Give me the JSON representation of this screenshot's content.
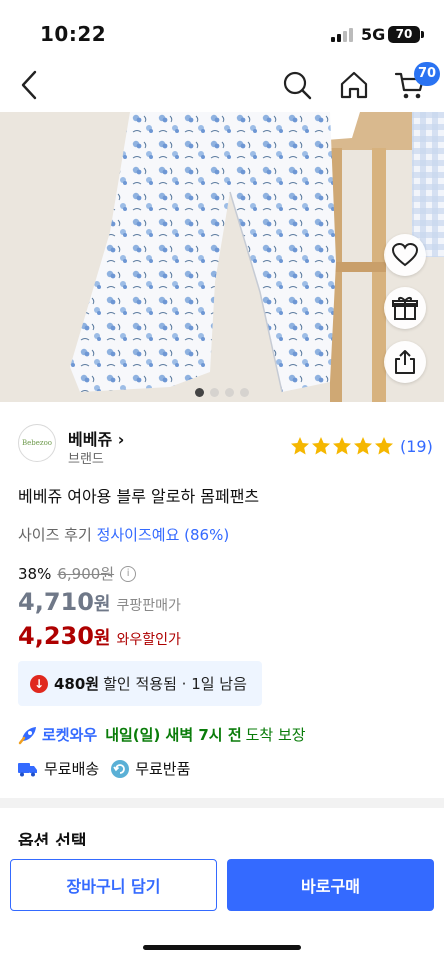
{
  "status": {
    "time": "10:22",
    "network": "5G",
    "battery": "70"
  },
  "nav": {
    "cart_count": "70",
    "icons": [
      "back-arrow-icon",
      "search-icon",
      "home-icon",
      "cart-icon"
    ]
  },
  "gallery": {
    "total_slides": 4,
    "active_index": 0
  },
  "brand": {
    "name": "베베쥬 ›",
    "sub": "브랜드",
    "logo_text": "Bebezoo"
  },
  "rating": {
    "stars": 5,
    "count": "(19)"
  },
  "product": {
    "title": "베베쥬 여아용 블루 알로하 몸페팬츠"
  },
  "size_review": {
    "label": "사이즈 후기",
    "value": "정사이즈예요 (86%)"
  },
  "pricing": {
    "discount": "38%",
    "original": "6,900원",
    "coupang_price": "4,710",
    "coupang_won": "원",
    "coupang_tag": "쿠팡판매가",
    "wow_price": "4,230",
    "wow_won": "원",
    "wow_tag": "와우할인가"
  },
  "coupon": {
    "amount": "480원",
    "text": "할인 적용됨 · 1일 남음"
  },
  "delivery": {
    "label": "로켓와우",
    "day": "내일(일) 새벽 7시 전",
    "suffix": "도착 보장"
  },
  "free": {
    "shipping": "무료배송",
    "returns": "무료반품"
  },
  "options": {
    "title": "옵션 선택"
  },
  "buttons": {
    "cart": "장바구니 담기",
    "buy": "바로구매"
  },
  "colors": {
    "accent": "#346aff",
    "sale": "#ae0000",
    "star": "#f5b700",
    "green": "#0a7c0a"
  }
}
